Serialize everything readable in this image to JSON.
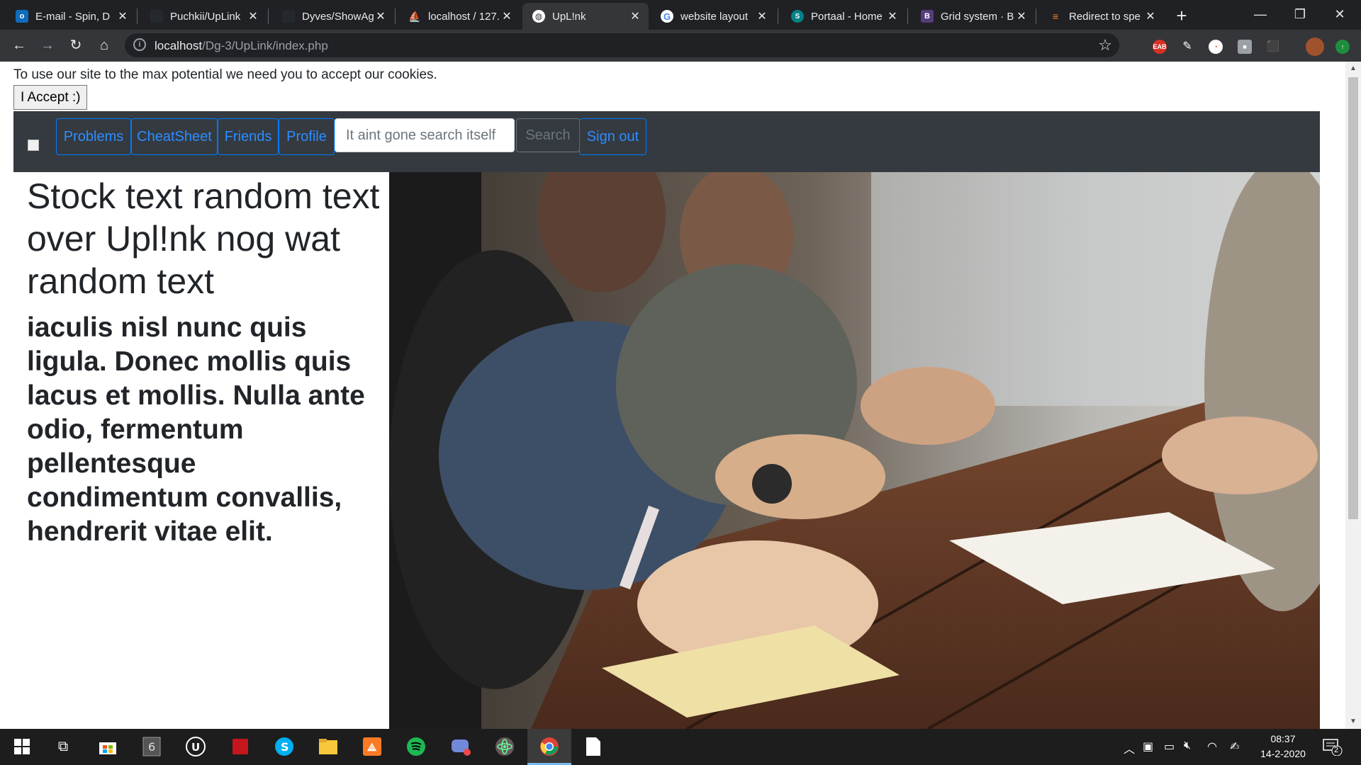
{
  "browser": {
    "tabs": [
      {
        "title": "E-mail - Spin, D",
        "icon": "outlook-icon",
        "color": "#0f6cbd"
      },
      {
        "title": "Puchkii/UpLink",
        "icon": "github-icon",
        "color": "#24292e"
      },
      {
        "title": "Dyves/ShowAg",
        "icon": "github-icon",
        "color": "#24292e"
      },
      {
        "title": "localhost / 127.",
        "icon": "phpmyadmin-icon",
        "color": "#f89c0e"
      },
      {
        "title": "UpL!nk",
        "icon": "globe-icon",
        "color": "#ffffff",
        "active": true
      },
      {
        "title": "website layout",
        "icon": "google-icon",
        "color": "#4285f4"
      },
      {
        "title": "Portaal - Home",
        "icon": "sharepoint-icon",
        "color": "#038387"
      },
      {
        "title": "Grid system · B",
        "icon": "bootstrap-icon",
        "color": "#563d7c"
      },
      {
        "title": "Redirect to spe",
        "icon": "stackoverflow-icon",
        "color": "#f48024"
      }
    ],
    "url_host": "localhost",
    "url_path": "/Dg-3/UpLink/index.php",
    "window_controls": {
      "minimize": "—",
      "restore": "❐",
      "close": "✕"
    }
  },
  "page": {
    "cookie_notice": "To use our site to the max potential we need you to accept our cookies.",
    "cookie_button": "I Accept :)",
    "nav": {
      "problems": "Problems",
      "cheatsheet": "CheatSheet",
      "friends": "Friends",
      "profile": "Profile",
      "search_placeholder": "It aint gone search itself",
      "search_button": "Search",
      "sign_out": "Sign out"
    },
    "headline": "Stock text random text over Upl!nk nog wat random text",
    "lead": "iaculis nisl nunc quis ligula. Donec mollis quis lacus et mollis. Nulla ante odio, fermentum pellentesque condimentum convallis, hendrerit vitae elit."
  },
  "taskbar": {
    "apps": [
      "windows-start-icon",
      "task-view-icon",
      "store-icon",
      "rainbow-six-icon",
      "unreal-icon",
      "app-red-icon",
      "skype-icon",
      "file-explorer-icon",
      "xampp-icon",
      "spotify-icon",
      "discord-icon",
      "atom-icon",
      "chrome-icon",
      "notepad-icon"
    ],
    "time": "08:37",
    "date": "14-2-2020",
    "notifications": "2"
  },
  "colors": {
    "navbar_bg": "#343a40",
    "nav_link": "#007bff",
    "tab_bar": "#202124",
    "toolbar": "#35363a"
  }
}
